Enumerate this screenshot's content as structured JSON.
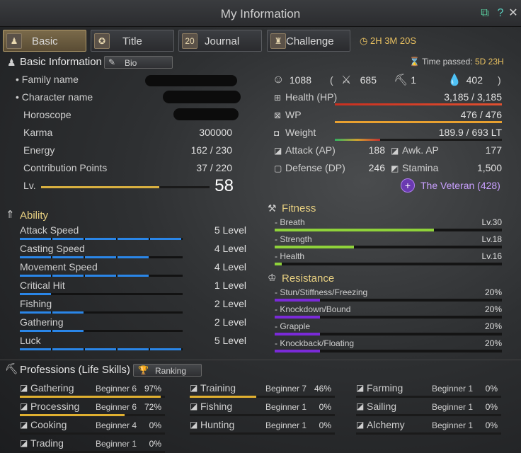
{
  "window": {
    "title": "My Information"
  },
  "tabs": [
    {
      "label": "Basic",
      "active": true,
      "icon": "person-icon"
    },
    {
      "label": "Title",
      "icon": "medal-icon"
    },
    {
      "label": "Journal",
      "icon": "calendar-icon"
    },
    {
      "label": "Challenge",
      "icon": "trophy-icon"
    }
  ],
  "timer": "2H 3M 20S",
  "basic_info": {
    "title": "Basic Information",
    "bio_label": "Bio",
    "time_passed_label": "Time passed:",
    "time_passed_value": "5D 23H",
    "family_name_label": "Family name",
    "character_name_label": "Character name",
    "horoscope_label": "Horoscope",
    "karma_label": "Karma",
    "karma_value": "300000",
    "energy_label": "Energy",
    "energy_value": "162 / 230",
    "cp_label": "Contribution Points",
    "cp_value": "37 / 220",
    "level_label": "Lv.",
    "level_value": "58",
    "level_progress": 0.7
  },
  "stats": {
    "total": "1088",
    "open_paren": "(",
    "close_paren": ")",
    "combat": "685",
    "life": "1",
    "other": "402",
    "hp_label": "Health (HP)",
    "hp_value": "3,185 / 3,185",
    "hp_fraction": 1.0,
    "wp_label": "WP",
    "wp_value": "476 / 476",
    "wp_fraction": 1.0,
    "weight_label": "Weight",
    "weight_value": "189.9 / 693 LT",
    "weight_fraction": 0.27,
    "ap_label": "Attack (AP)",
    "ap_value": "188",
    "awk_label": "Awk. AP",
    "awk_value": "177",
    "dp_label": "Defense (DP)",
    "dp_value": "246",
    "stamina_label": "Stamina",
    "stamina_value": "1,500",
    "title_label": "The Veteran (428)"
  },
  "ability": {
    "title": "Ability",
    "items": [
      {
        "label": "Attack Speed",
        "level": "5 Level",
        "n": 5
      },
      {
        "label": "Casting Speed",
        "level": "4 Level",
        "n": 4
      },
      {
        "label": "Movement Speed",
        "level": "4 Level",
        "n": 4
      },
      {
        "label": "Critical Hit",
        "level": "1 Level",
        "n": 1
      },
      {
        "label": "Fishing",
        "level": "2 Level",
        "n": 2
      },
      {
        "label": "Gathering",
        "level": "2 Level",
        "n": 2
      },
      {
        "label": "Luck",
        "level": "5 Level",
        "n": 5
      }
    ]
  },
  "fitness": {
    "title": "Fitness",
    "items": [
      {
        "label": "- Breath",
        "level": "Lv.30",
        "fraction": 0.7
      },
      {
        "label": "- Strength",
        "level": "Lv.18",
        "fraction": 0.35
      },
      {
        "label": "- Health",
        "level": "Lv.16",
        "fraction": 0.03
      }
    ]
  },
  "resistance": {
    "title": "Resistance",
    "items": [
      {
        "label": "- Stun/Stiffness/Freezing",
        "value": "20%",
        "fraction": 0.2
      },
      {
        "label": "- Knockdown/Bound",
        "value": "20%",
        "fraction": 0.2
      },
      {
        "label": "- Grapple",
        "value": "20%",
        "fraction": 0.2
      },
      {
        "label": "- Knockback/Floating",
        "value": "20%",
        "fraction": 0.2
      }
    ]
  },
  "professions": {
    "title": "Professions (Life Skills)",
    "ranking_label": "Ranking",
    "items": [
      {
        "label": "Gathering",
        "grade": "Beginner 6",
        "pct": "97%",
        "fraction": 0.97
      },
      {
        "label": "Training",
        "grade": "Beginner 7",
        "pct": "46%",
        "fraction": 0.46
      },
      {
        "label": "Farming",
        "grade": "Beginner 1",
        "pct": "0%",
        "fraction": 0
      },
      {
        "label": "Processing",
        "grade": "Beginner 6",
        "pct": "72%",
        "fraction": 0.72
      },
      {
        "label": "Fishing",
        "grade": "Beginner 1",
        "pct": "0%",
        "fraction": 0
      },
      {
        "label": "Sailing",
        "grade": "Beginner 1",
        "pct": "0%",
        "fraction": 0
      },
      {
        "label": "Cooking",
        "grade": "Beginner 4",
        "pct": "0%",
        "fraction": 0
      },
      {
        "label": "Hunting",
        "grade": "Beginner 1",
        "pct": "0%",
        "fraction": 0
      },
      {
        "label": "Alchemy",
        "grade": "Beginner 1",
        "pct": "0%",
        "fraction": 0
      },
      {
        "label": "Trading",
        "grade": "Beginner 1",
        "pct": "0%",
        "fraction": 0
      }
    ]
  }
}
